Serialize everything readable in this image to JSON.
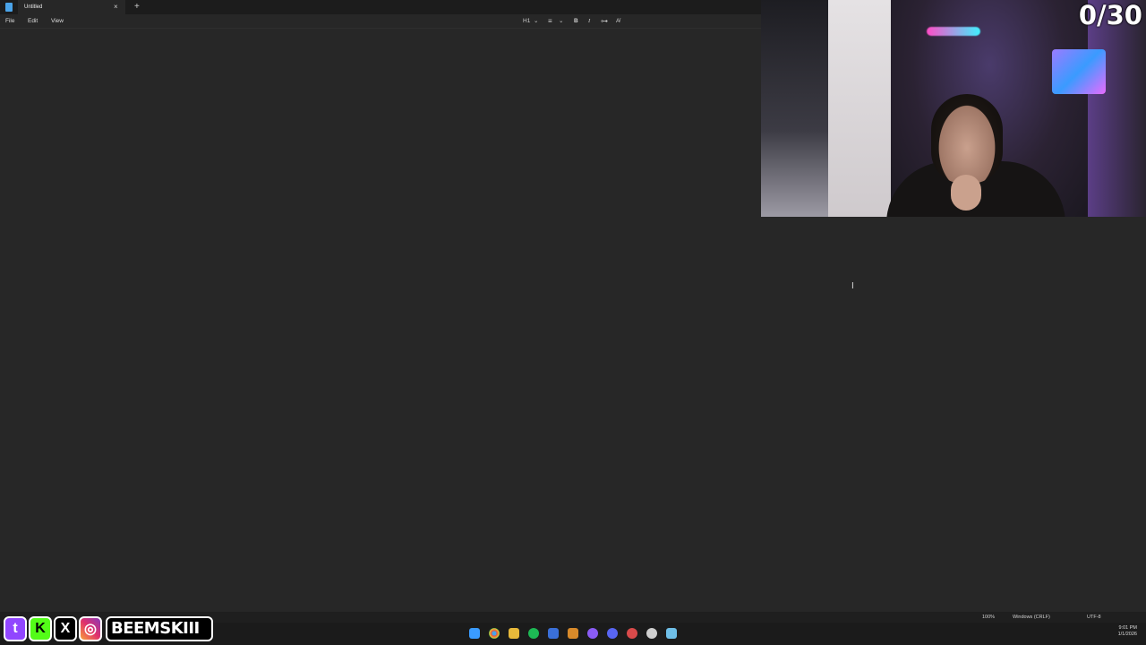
{
  "tab": {
    "title": "Untitled",
    "close_icon": "×",
    "new_tab_icon": "+"
  },
  "menu": {
    "items": [
      "File",
      "Edit",
      "View"
    ]
  },
  "toolbar": {
    "heading": "H1",
    "heading_chevron": "⌄",
    "list_icon": "≡",
    "list_chevron": "⌄",
    "bold": "B",
    "italic": "I",
    "link_icon": "⊶",
    "clear_format_icon": "A̸"
  },
  "webcam": {
    "counter": "0/30"
  },
  "statusbar": {
    "zoom": "100%",
    "line_endings": "Windows (CRLF)",
    "encoding": "UTF-8"
  },
  "taskbar": {
    "time": "9:01 PM",
    "date": "1/1/2026"
  },
  "overlay": {
    "handle": "BEEMSKIII",
    "twitch": "t",
    "kick": "K",
    "x": "X",
    "instagram": "◎"
  }
}
